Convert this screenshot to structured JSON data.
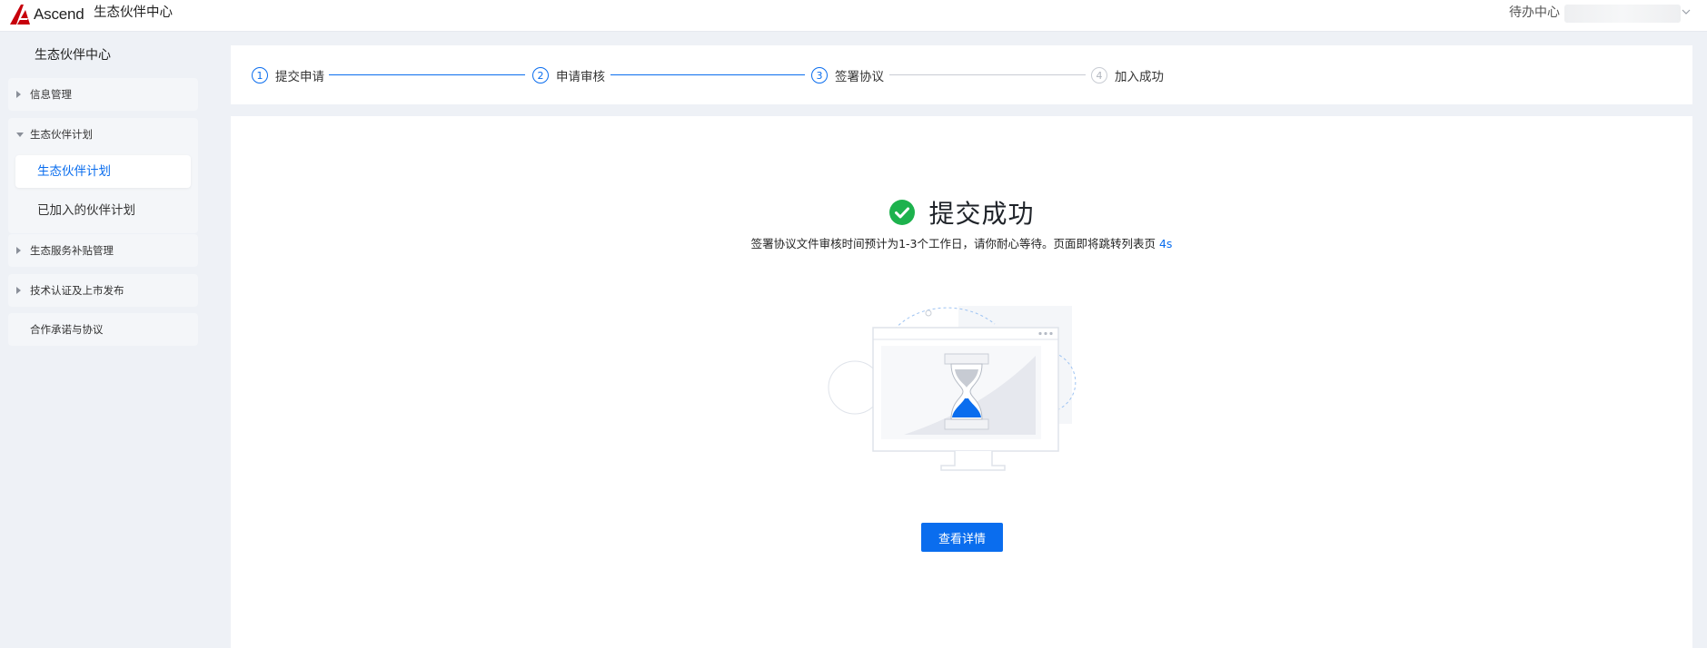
{
  "header": {
    "logo_text": "Ascend",
    "app_title": "生态伙伴中心",
    "todo_label": "待办中心"
  },
  "sidebar": {
    "title": "生态伙伴中心",
    "groups": [
      {
        "label": "信息管理",
        "expanded": false
      },
      {
        "label": "生态伙伴计划",
        "expanded": true,
        "items": [
          {
            "label": "生态伙伴计划",
            "active": true
          },
          {
            "label": "已加入的伙伴计划",
            "active": false
          }
        ]
      },
      {
        "label": "生态服务补贴管理",
        "expanded": false
      },
      {
        "label": "技术认证及上市发布",
        "expanded": false
      },
      {
        "label": "合作承诺与协议",
        "expanded": false
      }
    ]
  },
  "steps": [
    {
      "num": "1",
      "label": "提交申请",
      "status": "done"
    },
    {
      "num": "2",
      "label": "申请审核",
      "status": "done"
    },
    {
      "num": "3",
      "label": "签署协议",
      "status": "current"
    },
    {
      "num": "4",
      "label": "加入成功",
      "status": "pending"
    }
  ],
  "result": {
    "title": "提交成功",
    "description": "签署协议文件审核时间预计为1-3个工作日，请你耐心等待。页面即将跳转列表页",
    "countdown": "4s",
    "button_label": "查看详情"
  },
  "colors": {
    "primary": "#0a6dee",
    "success": "#1db24d",
    "page_bg": "#eef1f6"
  },
  "icons": {
    "logo": "ascend-logo-icon",
    "user_menu": "chevron-down-icon",
    "status": "check-circle-icon",
    "illustration": "hourglass-monitor-illustration"
  }
}
